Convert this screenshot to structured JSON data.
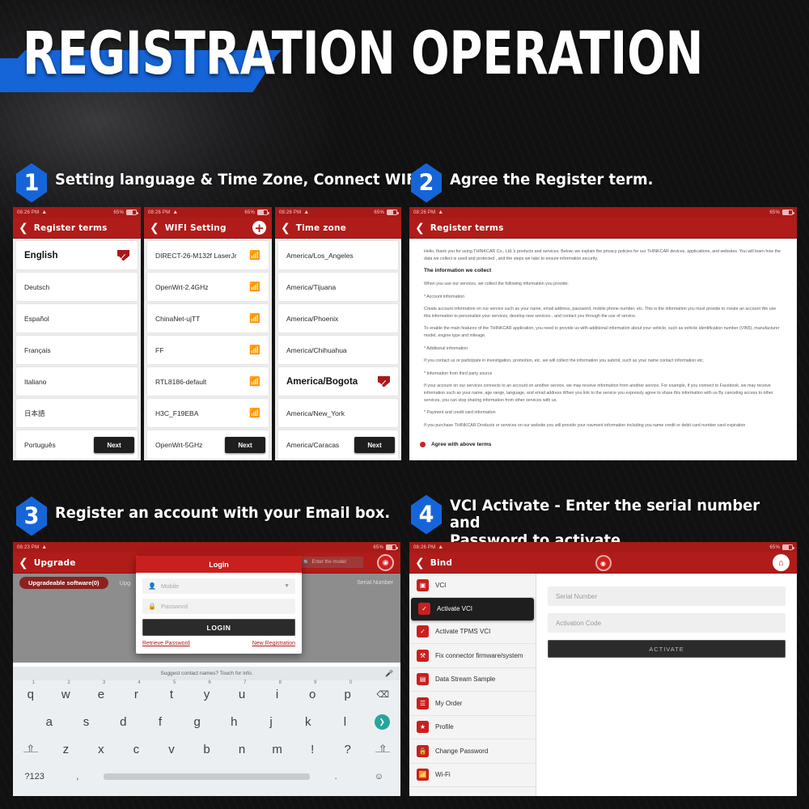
{
  "banner": {
    "title": "REGISTRATION OPERATION"
  },
  "steps": [
    {
      "num": "1",
      "text": "Setting language & Time Zone, Connect WIFI."
    },
    {
      "num": "2",
      "text": "Agree the Register term."
    },
    {
      "num": "3",
      "text": "Register an account with your Email box."
    },
    {
      "num": "4",
      "text": "VCI Activate - Enter the serial number and\nPassword to activate."
    }
  ],
  "statusbar": {
    "time": "08:26 PM",
    "battery": "65%"
  },
  "statusbar3": {
    "time": "08:23 PM",
    "battery": "65%"
  },
  "panel_language": {
    "nav_title": "Register terms",
    "next_label": "Next",
    "items": [
      {
        "label": "English",
        "selected": true
      },
      {
        "label": "Deutsch",
        "selected": false
      },
      {
        "label": "Español",
        "selected": false
      },
      {
        "label": "Français",
        "selected": false
      },
      {
        "label": "Italiano",
        "selected": false
      },
      {
        "label": "日本語",
        "selected": false
      },
      {
        "label": "Português",
        "selected": false
      }
    ]
  },
  "panel_wifi": {
    "nav_title": "WIFI Setting",
    "next_label": "Next",
    "add_icon": "plus-icon",
    "items": [
      {
        "ssid": "DIRECT-26-M132f LaserJr",
        "strength": "strong"
      },
      {
        "ssid": "OpenWrt-2.4GHz",
        "strength": "weak"
      },
      {
        "ssid": "ChinaNet-ujTT",
        "strength": "strong"
      },
      {
        "ssid": "FF",
        "strength": "weak"
      },
      {
        "ssid": "RTL8186-default",
        "strength": "strong"
      },
      {
        "ssid": "H3C_F19EBA",
        "strength": "weak"
      },
      {
        "ssid": "OpenWrt-5GHz",
        "strength": "weak"
      }
    ]
  },
  "panel_timezone": {
    "nav_title": "Time zone",
    "next_label": "Next",
    "items": [
      {
        "label": "America/Los_Angeles",
        "selected": false
      },
      {
        "label": "America/Tijuana",
        "selected": false
      },
      {
        "label": "America/Phoenix",
        "selected": false
      },
      {
        "label": "America/Chihuahua",
        "selected": false
      },
      {
        "label": "America/Bogota",
        "selected": true
      },
      {
        "label": "America/New_York",
        "selected": false
      },
      {
        "label": "America/Caracas",
        "selected": false
      }
    ]
  },
  "panel_terms": {
    "nav_title": "Register terms",
    "intro": "Hello, thank you for using THINKCAR Co., Ltd.'s products and services. Below, we explain the privacy policies for our THINKCAR devices, applications, and websites. You will learn how the data we collect is used and protected , and the steps we take to ensure information security.",
    "heading": "The information we collect",
    "p1": "When you use our services, we collect the following information you provide.",
    "p2": "* Account information",
    "p3": "Create account information on our service such as your name, email address, password, mobile phone number, etc. This is the information you must provide to create an account We use this information to personalize your services, develop new services , and contact you through the use of service.",
    "p4": "To enable the main features of the THINKCAR application, you need to provide us with additional information about your vehicle, such as vehicle identification number (VIN5), manufacturer model, engine type and mileage.",
    "p5": "* Additional information",
    "p6": "If you contact us or participate in investigation, promotion, etc. we will collect the information you submit, such as your name contact information etc.",
    "p7": "* Information from third party source",
    "p8": "If your account on our services connects to an account on another service, we may receive information from another service. For example, if you connect to Facebook, we may receive information such as your name, age range, language, and email address When you link to the service you expressly agree to share this information with us By canceling access to other services, you can stop sharing information from other services with us.",
    "p9": "* Payment and credit card information",
    "p10": "If you purchase THINKCAR Droducts or services on our website you will provide your navment information including you name credit or debit card number card expiration",
    "agree_label": "Agree with above terms"
  },
  "panel_login": {
    "nav_title": "Upgrade",
    "search_placeholder": "Enter the model",
    "tab_pill": "Upgradeable software(0)",
    "tab_second": "Upg",
    "serial_label": "Serial Number",
    "camera_icon": "camera-icon",
    "dialog": {
      "title": "Login",
      "mobile_placeholder": "Mobile",
      "password_placeholder": "Password",
      "login_label": "LOGIN",
      "retrieve_label": "Retrieve Password",
      "register_label": "New Registration"
    },
    "keyboard": {
      "suggestion": "Suggest contact names? Touch for info.",
      "row1": [
        {
          "k": "q",
          "n": "1"
        },
        {
          "k": "w",
          "n": "2"
        },
        {
          "k": "e",
          "n": "3"
        },
        {
          "k": "r",
          "n": "4"
        },
        {
          "k": "t",
          "n": "5"
        },
        {
          "k": "y",
          "n": "6"
        },
        {
          "k": "u",
          "n": "7"
        },
        {
          "k": "i",
          "n": "8"
        },
        {
          "k": "o",
          "n": "9"
        },
        {
          "k": "p",
          "n": "0"
        }
      ],
      "row2": [
        "a",
        "s",
        "d",
        "f",
        "g",
        "h",
        "j",
        "k",
        "l"
      ],
      "row3": [
        "z",
        "x",
        "c",
        "v",
        "b",
        "n",
        "m",
        "!",
        "?"
      ],
      "numkey": "?123",
      "comma": ",",
      "period": ".",
      "backspace": "⌫",
      "enter": "❯",
      "shift": "⇧",
      "emoji": "☺",
      "mic": "⬤"
    }
  },
  "panel_bind": {
    "nav_title": "Bind",
    "camera_icon": "camera-icon",
    "home_icon": "home-icon",
    "sidebar": [
      {
        "label": "VCI",
        "icon": "device-icon",
        "active": false
      },
      {
        "label": "Activate VCI",
        "icon": "shield-check-icon",
        "active": true
      },
      {
        "label": "Activate TPMS VCI",
        "icon": "shield-check-icon",
        "active": false
      },
      {
        "label": "Fix connector firmware/system",
        "icon": "tools-icon",
        "active": false
      },
      {
        "label": "Data Stream Sample",
        "icon": "chart-icon",
        "active": false
      },
      {
        "label": "My Order",
        "icon": "clipboard-icon",
        "active": false
      },
      {
        "label": "Profile",
        "icon": "profile-icon",
        "active": false
      },
      {
        "label": "Change Password",
        "icon": "lock-icon",
        "active": false
      },
      {
        "label": "Wi-Fi",
        "icon": "wifi-icon",
        "active": false
      }
    ],
    "serial_placeholder": "Serial Number",
    "activation_placeholder": "Activation Code",
    "activate_label": "ACTIVATE"
  },
  "colors": {
    "brand_red": "#b01c1a",
    "accent_blue": "#1565d8",
    "dark": "#1e1e1e"
  }
}
